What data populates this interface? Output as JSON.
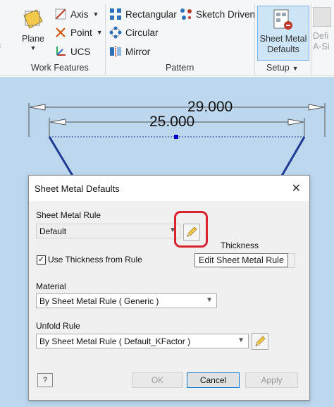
{
  "ribbon": {
    "work_features": {
      "label": "Work Features",
      "plane": "Plane",
      "axis": "Axis",
      "point": "Point",
      "ucs": "UCS"
    },
    "pattern": {
      "label": "Pattern",
      "rectangular": "Rectangular",
      "sketch_driven": "Sketch Driven",
      "circular": "Circular",
      "mirror": "Mirror"
    },
    "setup": {
      "label": "Setup",
      "sheet_metal_defaults_line1": "Sheet Metal",
      "sheet_metal_defaults_line2": "Defaults"
    },
    "cut": {
      "defi_line1": "Defi",
      "defi_line2": "A-Si"
    }
  },
  "sketch": {
    "dim_outer": "29.000",
    "dim_inner": "25.000"
  },
  "dialog": {
    "title": "Sheet Metal Defaults",
    "sheet_metal_rule_label": "Sheet Metal Rule",
    "sheet_metal_rule_value": "Default",
    "thickness_label": "Thickness",
    "use_thickness_label": "Use Thickness from Rule",
    "use_thickness_checked": true,
    "tooltip": "Edit Sheet Metal Rule",
    "material_label": "Material",
    "material_value": "By Sheet Metal Rule ( Generic )",
    "unfold_rule_label": "Unfold Rule",
    "unfold_rule_value": "By Sheet Metal Rule ( Default_KFactor )",
    "ok": "OK",
    "cancel": "Cancel",
    "apply": "Apply",
    "help": "?"
  },
  "colors": {
    "canvas": "#bcd7ee",
    "highlight": "#d9232e",
    "selected_button": "#cde5f7"
  }
}
